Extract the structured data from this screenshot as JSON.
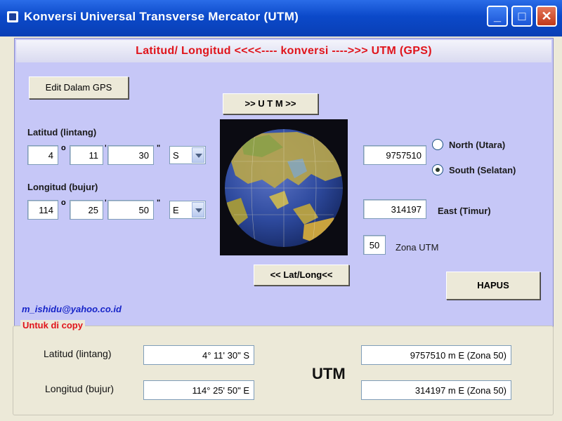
{
  "window": {
    "title": "Konversi Universal Transverse Mercator (UTM)",
    "minimize": "_",
    "maximize": "□",
    "close": "✕"
  },
  "header": {
    "text": "Latitud/ Longitud  <<<<---- konversi ---->>>  UTM  (GPS)"
  },
  "buttons": {
    "edit_gps": "Edit Dalam GPS",
    "to_utm": ">> U T M >>",
    "to_latlong": "<< Lat/Long<<",
    "hapus": "HAPUS"
  },
  "latitude": {
    "label": "Latitud (lintang)",
    "deg": "4",
    "min": "11",
    "sec": "30",
    "hemisphere": "S",
    "deg_symbol": "o",
    "min_symbol": "'",
    "sec_symbol": "\""
  },
  "longitude": {
    "label": "Longitud (bujur)",
    "deg": "114",
    "min": "25",
    "sec": "50",
    "hemisphere": "E",
    "deg_symbol": "o",
    "min_symbol": "'",
    "sec_symbol": "\""
  },
  "utm": {
    "north": "9757510",
    "east": "314197",
    "zone": "50",
    "radio_north": "North (Utara)",
    "radio_south": "South (Selatan)",
    "east_label": "East (Timur)",
    "zone_label": "Zona UTM",
    "selected": "south"
  },
  "email": "m_ishidu@yahoo.co.id",
  "copy_group": {
    "title": "Untuk di copy",
    "lat_label": "Latitud (lintang)",
    "long_label": "Longitud (bujur)",
    "lat_value": "4° 11' 30\" S",
    "long_value": "114° 25' 50\" E",
    "utm_label": "UTM",
    "utm_north": "9757510 m E (Zona 50)",
    "utm_east": "314197 m E (Zona 50)"
  },
  "colors": {
    "title_blue": "#0b49c9",
    "panel_lavender": "#c6c7f7",
    "header_red": "#e0141b",
    "email_blue": "#1624c8"
  },
  "icons": {
    "app": "window-app-icon",
    "globe": "earth-globe-icon"
  }
}
